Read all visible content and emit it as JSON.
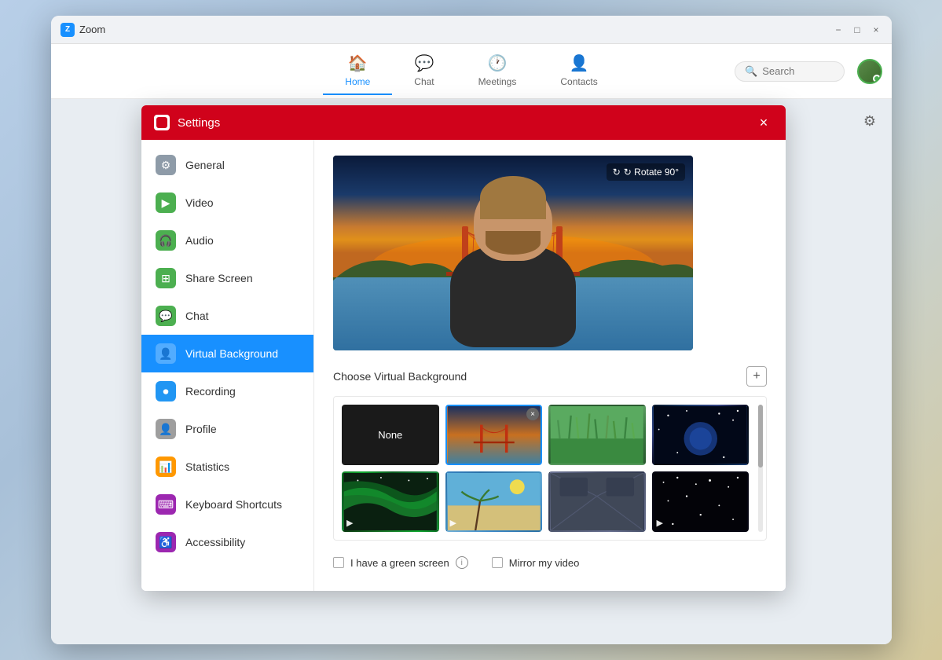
{
  "app": {
    "title": "Zoom",
    "window_controls": {
      "minimize": "−",
      "maximize": "□",
      "close": "×"
    }
  },
  "nav": {
    "tabs": [
      {
        "id": "home",
        "label": "Home",
        "icon": "🏠",
        "active": true
      },
      {
        "id": "chat",
        "label": "Chat",
        "icon": "💬",
        "active": false
      },
      {
        "id": "meetings",
        "label": "Meetings",
        "icon": "🕐",
        "active": false
      },
      {
        "id": "contacts",
        "label": "Contacts",
        "icon": "👤",
        "active": false
      }
    ],
    "search": {
      "placeholder": "Search"
    }
  },
  "settings": {
    "title": "Settings",
    "close_label": "×",
    "rotate_label": "↻ Rotate 90°",
    "sidebar": {
      "items": [
        {
          "id": "general",
          "label": "General",
          "icon": "⚙"
        },
        {
          "id": "video",
          "label": "Video",
          "icon": "📹"
        },
        {
          "id": "audio",
          "label": "Audio",
          "icon": "🎧"
        },
        {
          "id": "share-screen",
          "label": "Share Screen",
          "icon": "📤"
        },
        {
          "id": "chat",
          "label": "Chat",
          "icon": "💬"
        },
        {
          "id": "virtual-background",
          "label": "Virtual Background",
          "icon": "👤",
          "active": true
        },
        {
          "id": "recording",
          "label": "Recording",
          "icon": "⏺"
        },
        {
          "id": "profile",
          "label": "Profile",
          "icon": "👤"
        },
        {
          "id": "statistics",
          "label": "Statistics",
          "icon": "📊"
        },
        {
          "id": "keyboard-shortcuts",
          "label": "Keyboard Shortcuts",
          "icon": "⌨"
        },
        {
          "id": "accessibility",
          "label": "Accessibility",
          "icon": "♿"
        }
      ]
    },
    "content": {
      "section_title": "Choose Virtual Background",
      "add_button": "+",
      "none_label": "None",
      "rotate_button": "↻ Rotate 90°",
      "backgrounds": [
        {
          "id": "none",
          "type": "none",
          "label": "None"
        },
        {
          "id": "golden-gate",
          "type": "image",
          "label": "Golden Gate",
          "selected": true
        },
        {
          "id": "grass",
          "type": "image",
          "label": "Grass field"
        },
        {
          "id": "space",
          "type": "image",
          "label": "Space"
        },
        {
          "id": "aurora",
          "type": "video",
          "label": "Aurora"
        },
        {
          "id": "beach",
          "type": "video",
          "label": "Beach"
        },
        {
          "id": "interior",
          "type": "image",
          "label": "Interior"
        },
        {
          "id": "stars",
          "type": "video",
          "label": "Stars"
        }
      ],
      "checkboxes": [
        {
          "id": "green-screen",
          "label": "I have a green screen",
          "checked": false,
          "has_info": true
        },
        {
          "id": "mirror-video",
          "label": "Mirror my video",
          "checked": false
        }
      ]
    }
  }
}
